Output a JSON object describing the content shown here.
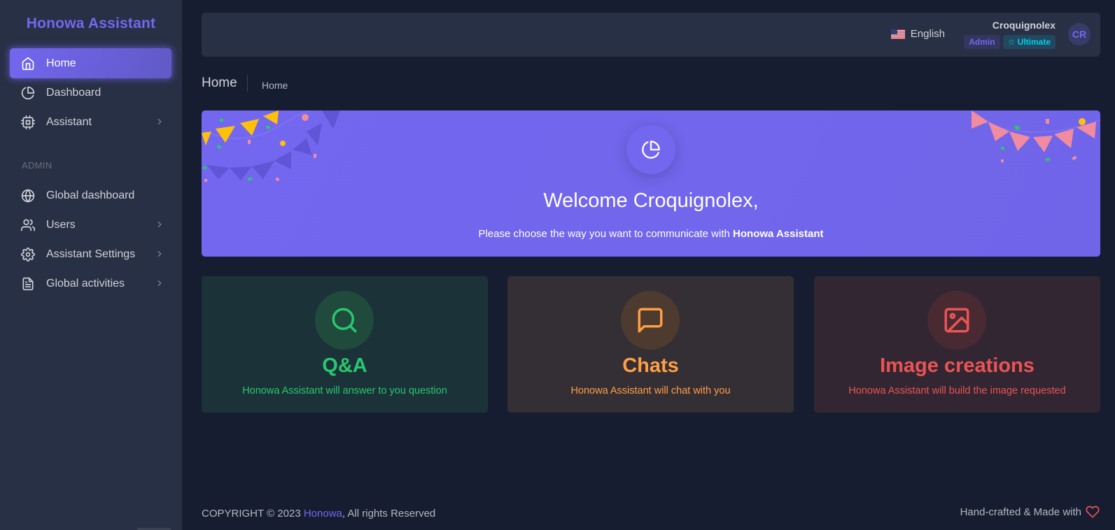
{
  "sidebar": {
    "brand": "Honowa Assistant",
    "section_admin": "ADMIN",
    "items": [
      {
        "label": "Home",
        "icon": "home-icon",
        "active": true
      },
      {
        "label": "Dashboard",
        "icon": "pie-chart-icon"
      },
      {
        "label": "Assistant",
        "icon": "cpu-icon",
        "has_children": true
      },
      {
        "label": "Global dashboard",
        "icon": "globe-icon"
      },
      {
        "label": "Users",
        "icon": "users-icon",
        "has_children": true
      },
      {
        "label": "Assistant Settings",
        "icon": "settings-icon",
        "has_children": true
      },
      {
        "label": "Global activities",
        "icon": "file-text-icon",
        "has_children": true
      }
    ]
  },
  "header": {
    "language": "English",
    "language_flag": "us-flag-icon",
    "user_name": "Croquignolex",
    "badge_admin": "Admin",
    "badge_plan": "Ultimate",
    "avatar_initials": "CR"
  },
  "breadcrumb": {
    "page_title": "Home",
    "crumb": "Home"
  },
  "banner": {
    "icon": "pie-chart-icon",
    "title": "Welcome Croquignolex,",
    "subtitle_prefix": "Please choose the way you want to communicate with",
    "subtitle_bold": "Honowa Assistant"
  },
  "cards": [
    {
      "title": "Q&A",
      "description": "Honowa Assistant will answer to you question",
      "icon": "search-icon",
      "color": "#28c76f"
    },
    {
      "title": "Chats",
      "description": "Honowa Assistant will chat with you",
      "icon": "message-square-icon",
      "color": "#ff9f43"
    },
    {
      "title": "Image creations",
      "description": "Honowa Assistant will build the image requested",
      "icon": "image-icon",
      "color": "#ea5455"
    }
  ],
  "footer": {
    "copyright_prefix": "COPYRIGHT © 2023",
    "brand_link": "Honowa",
    "copyright_suffix": ", All rights Reserved",
    "right_text": "Hand-crafted & Made with",
    "heart_icon": "heart-icon"
  },
  "colors": {
    "primary": "#7367f0",
    "success": "#28c76f",
    "warning": "#ff9f43",
    "danger": "#ea5455",
    "info": "#00cfe8",
    "body_bg": "#161d31",
    "card_bg": "#283046"
  }
}
